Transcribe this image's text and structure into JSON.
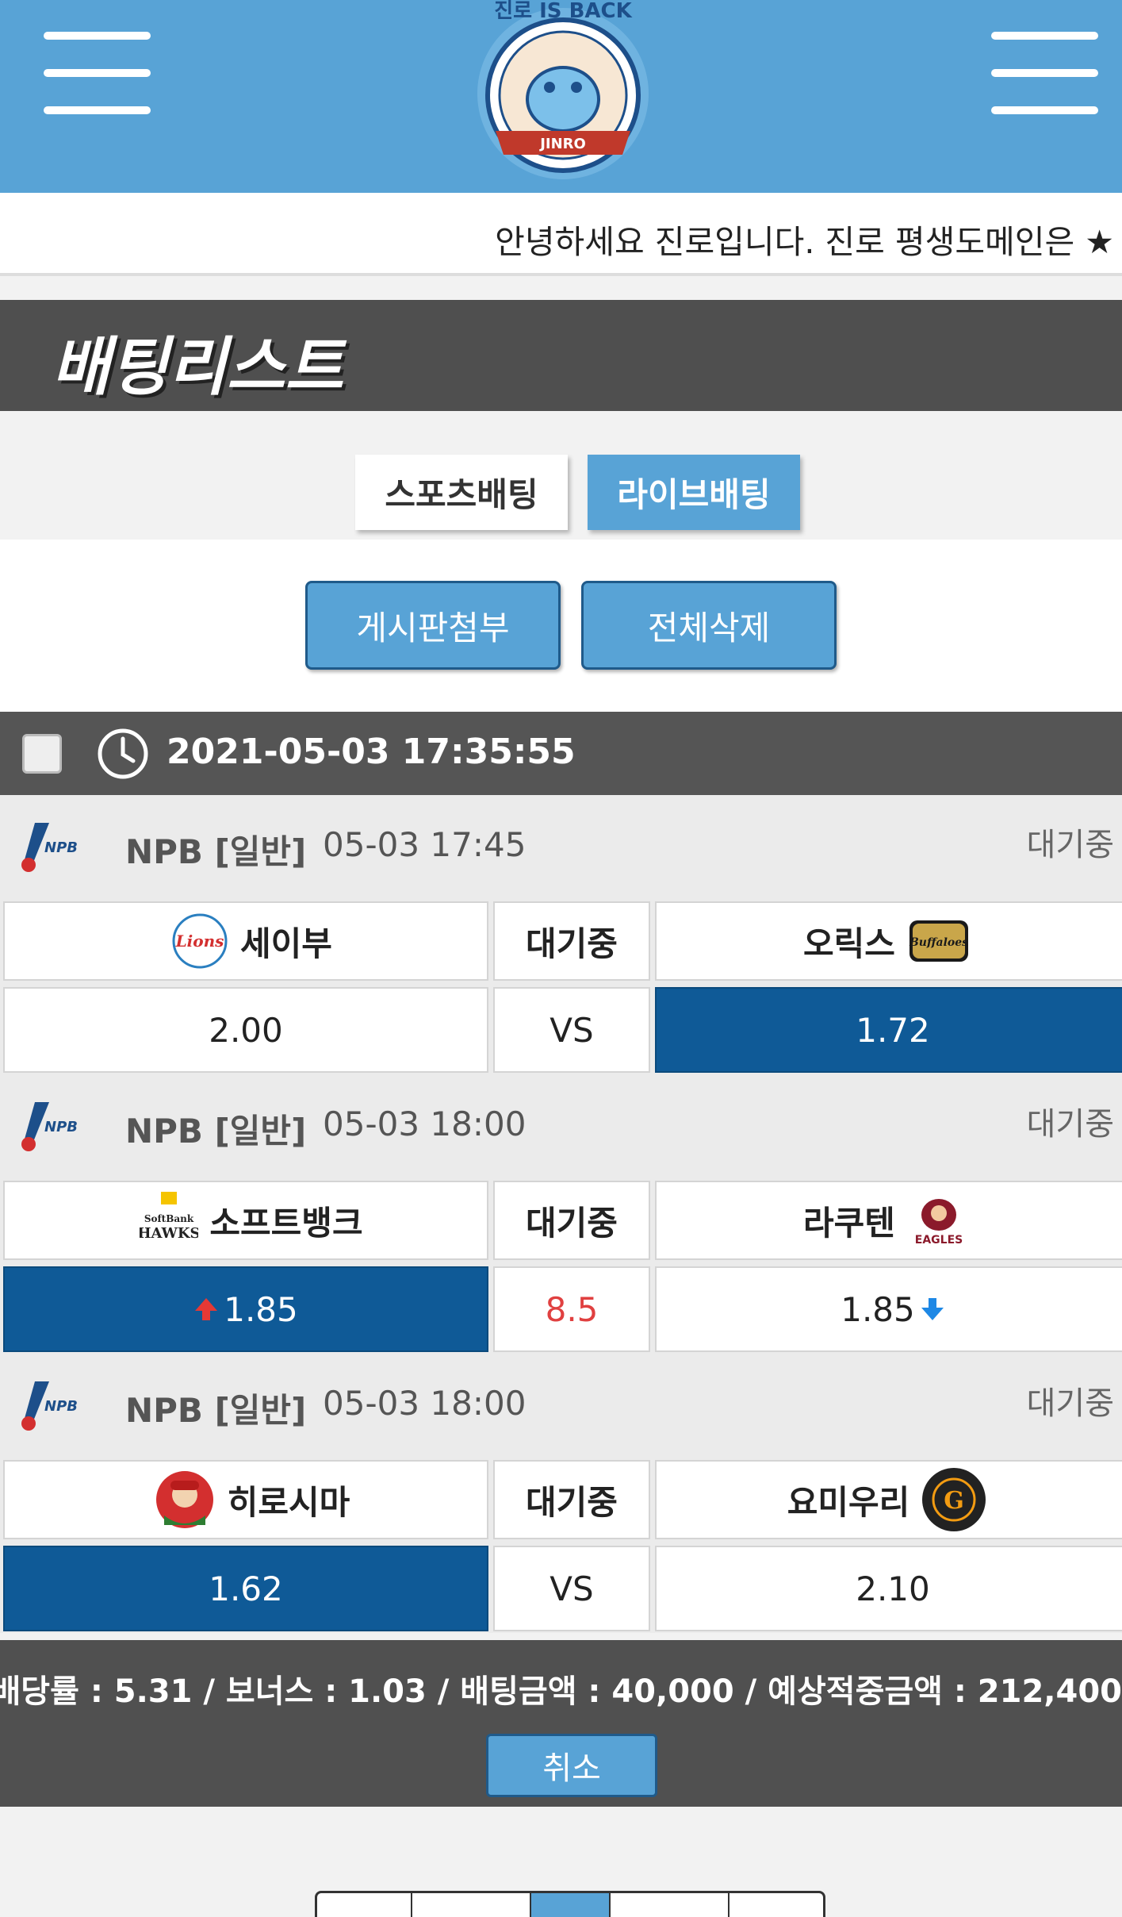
{
  "header": {
    "logo_top_text": "진로 IS BACK",
    "logo_badge_text": "JINRO"
  },
  "ticker": {
    "text": "안녕하세요 진로입니다. 진로 평생도메인은 ★"
  },
  "page": {
    "title": "배팅리스트"
  },
  "tabs": [
    {
      "label": "스포츠배팅",
      "active": false
    },
    {
      "label": "라이브배팅",
      "active": true
    }
  ],
  "actions": {
    "attach_label": "게시판첨부",
    "delete_all_label": "전체삭제"
  },
  "ticket": {
    "datetime": "2021-05-03 17:35:55",
    "games": [
      {
        "league": "NPB [일반]",
        "time": "05-03 17:45",
        "status": "대기중",
        "home": "세이부",
        "home_icon": "lions-logo-icon",
        "mid_label": "대기중",
        "away": "오릭스",
        "away_icon": "buffaloes-logo-icon",
        "home_odds": "2.00",
        "mid_value": "VS",
        "away_odds": "1.72",
        "selected": "away"
      },
      {
        "league": "NPB [일반]",
        "time": "05-03 18:00",
        "status": "대기중",
        "home": "소프트뱅크",
        "home_icon": "hawks-logo-icon",
        "mid_label": "대기중",
        "away": "라쿠텐",
        "away_icon": "eagles-logo-icon",
        "home_odds": "1.85",
        "mid_value": "8.5",
        "away_odds": "1.85",
        "home_trend": "up-arrow-icon",
        "away_trend": "down-arrow-icon",
        "selected": "home"
      },
      {
        "league": "NPB [일반]",
        "time": "05-03 18:00",
        "status": "대기중",
        "home": "히로시마",
        "home_icon": "carp-logo-icon",
        "mid_label": "대기중",
        "away": "요미우리",
        "away_icon": "giants-logo-icon",
        "home_odds": "1.62",
        "mid_value": "VS",
        "away_odds": "2.10",
        "selected": "home"
      }
    ],
    "summary": "배당률 : 5.31 / 보너스 : 1.03 / 배팅금액 : 40,000 / 예상적중금액 : 212,400",
    "cancel_label": "취소"
  },
  "colors": {
    "header_blue": "#58a3d6",
    "selected_blue": "#0f5a97",
    "handicap_red": "#e04040",
    "dark_bar": "#555555"
  }
}
